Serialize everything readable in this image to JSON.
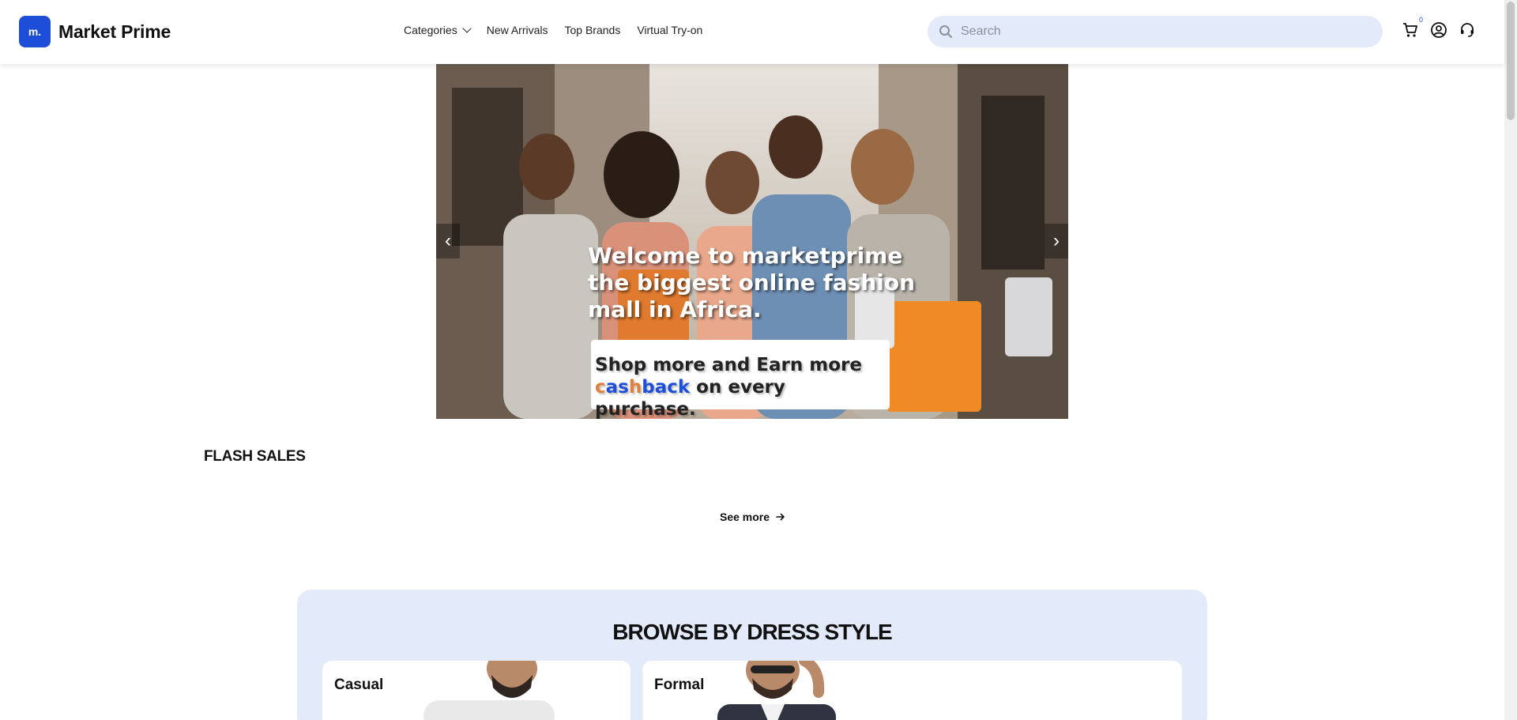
{
  "header": {
    "logo_mark": "m.",
    "brand": "Market Prime",
    "nav": [
      {
        "label": "Categories",
        "has_dropdown": true
      },
      {
        "label": "New Arrivals"
      },
      {
        "label": "Top Brands"
      },
      {
        "label": "Virtual Try-on"
      }
    ],
    "search": {
      "placeholder": "Search"
    },
    "icons": [
      "cart-icon",
      "user-icon",
      "headset-icon"
    ],
    "cart_count": "0"
  },
  "hero": {
    "title": "Welcome to marketprime the biggest online fashion mall in Africa.",
    "box_line1": "Shop more and Earn more",
    "box_cashback_c": "c",
    "box_cashback_as": "as",
    "box_cashback_h": "h",
    "box_cashback_back": "back",
    "box_line2_rest": " on every purchase.",
    "prev_arrow": "‹",
    "next_arrow": "›"
  },
  "flash_sales": {
    "title": "FLASH SALES",
    "see_more": "See more"
  },
  "browse": {
    "title": "BROWSE BY DRESS STYLE",
    "styles": [
      {
        "label": "Casual"
      },
      {
        "label": "Formal"
      }
    ]
  },
  "colors": {
    "brand_blue": "#1d4ed8",
    "light_blue_bg": "#e3ebfb",
    "accent_orange": "#e0803a"
  }
}
